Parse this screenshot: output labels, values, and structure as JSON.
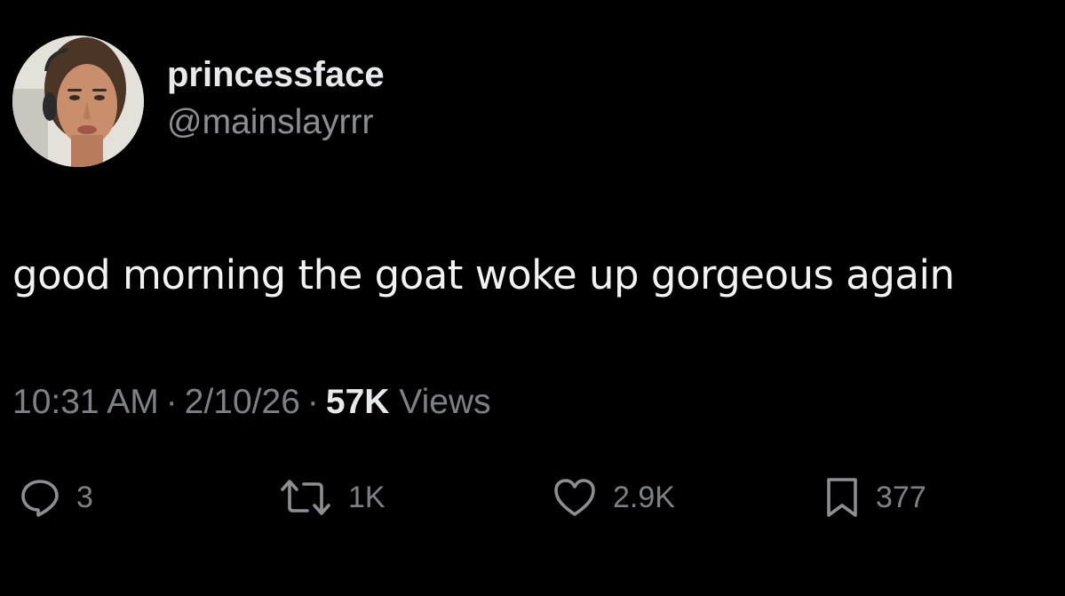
{
  "user": {
    "display_name": "princessface",
    "handle": "@mainslayrrr"
  },
  "tweet": {
    "text": "good morning the goat woke up gorgeous again"
  },
  "meta": {
    "time": "10:31 AM",
    "separator": "·",
    "date": "2/10/26",
    "views_count": "57K",
    "views_label": "Views"
  },
  "actions": {
    "reply": {
      "icon": "reply-icon",
      "count": "3"
    },
    "retweet": {
      "icon": "retweet-icon",
      "count": "1K"
    },
    "like": {
      "icon": "heart-icon",
      "count": "2.9K"
    },
    "bookmark": {
      "icon": "bookmark-icon",
      "count": "377"
    }
  },
  "colors": {
    "background": "#000000",
    "primary_text": "#e7e9ea",
    "secondary_text": "#7d8185"
  }
}
